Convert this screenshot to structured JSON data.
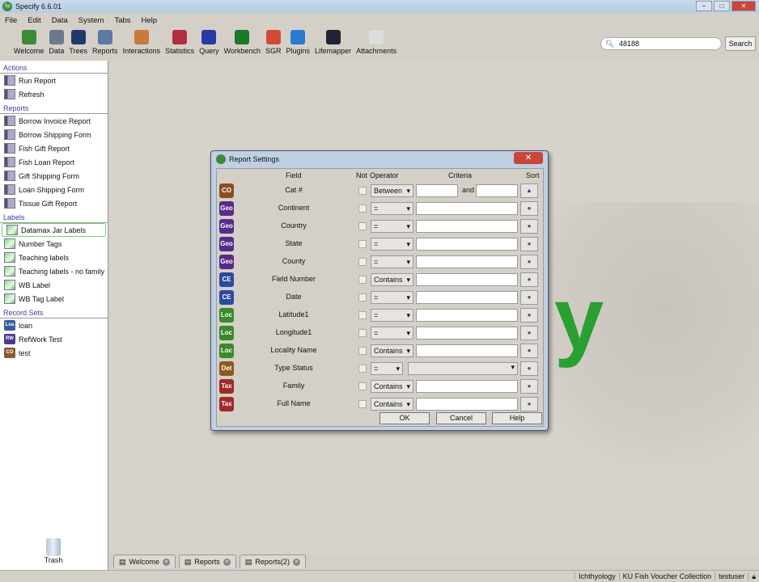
{
  "window": {
    "title": "Specify 6.6.01"
  },
  "menu": [
    "File",
    "Edit",
    "Data",
    "System",
    "Tabs",
    "Help"
  ],
  "toolbar": [
    {
      "label": "Welcome",
      "icon": "welcome-icon",
      "color": "#3a8a3a"
    },
    {
      "label": "Data",
      "icon": "data-icon",
      "color": "#6a7a8a"
    },
    {
      "label": "Trees",
      "icon": "trees-icon",
      "color": "#1f3a6a"
    },
    {
      "label": "Reports",
      "icon": "reports-icon",
      "color": "#5a7aa8"
    },
    {
      "label": "Interactions",
      "icon": "interactions-icon",
      "color": "#c87a3a"
    },
    {
      "label": "Statistics",
      "icon": "statistics-icon",
      "color": "#b03040"
    },
    {
      "label": "Query",
      "icon": "query-icon",
      "color": "#2a3aa0"
    },
    {
      "label": "Workbench",
      "icon": "workbench-icon",
      "color": "#1a7a2a"
    },
    {
      "label": "SGR",
      "icon": "sgr-icon",
      "color": "#d04a3a"
    },
    {
      "label": "Plugins",
      "icon": "plugins-icon",
      "color": "#2a7ad0"
    },
    {
      "label": "Lifemapper",
      "icon": "lifemapper-icon",
      "color": "#223"
    },
    {
      "label": "Attachments",
      "icon": "attachments-icon",
      "color": "#ddd"
    }
  ],
  "search": {
    "value": "48188",
    "button": "Search"
  },
  "sidebar": {
    "actions": {
      "title": "Actions",
      "items": [
        "Run Report",
        "Refresh"
      ]
    },
    "reports": {
      "title": "Reports",
      "items": [
        "Borrow Invoice Report",
        "Borrow Shipping Form",
        "Fish Gift Report",
        "Fish Loan Report",
        "Gift Shipping Form",
        "Loan Shipping Form",
        "Tissue Gift Report"
      ]
    },
    "labels": {
      "title": "Labels",
      "items": [
        "Datamax Jar Labels",
        "Number Tags",
        "Teaching labels",
        "Teaching labels - no family",
        "WB Label",
        "WB Tag Label"
      ],
      "selected": "Datamax Jar Labels"
    },
    "record_sets": {
      "title": "Record Sets",
      "items": [
        {
          "badge": "Loa",
          "label": "loan",
          "color": "#3a5aa0"
        },
        {
          "badge": "RW",
          "label": "RefWork Test",
          "color": "#4a3a8a"
        },
        {
          "badge": "CO",
          "label": "test",
          "color": "#8a5a2a"
        }
      ]
    },
    "trash": "Trash"
  },
  "logo_letter": "y",
  "tabs": [
    "Welcome",
    "Reports",
    "Reports(2)"
  ],
  "status": [
    "Ichthyology",
    "KU Fish Voucher Collection",
    "testuser"
  ],
  "dialog": {
    "title": "Report Settings",
    "headers": {
      "field": "Field",
      "not": "Not",
      "operator": "Operator",
      "criteria": "Criteria",
      "sort": "Sort"
    },
    "rows": [
      {
        "badge": "CO",
        "color": "#8a5020",
        "field": "Cat #",
        "operator": "Between",
        "between": "and",
        "sort": "ascending"
      },
      {
        "badge": "Geo",
        "color": "#5a2a8a",
        "field": "Continent",
        "operator": "="
      },
      {
        "badge": "Geo",
        "color": "#5a2a8a",
        "field": "Country",
        "operator": "="
      },
      {
        "badge": "Geo",
        "color": "#5a2a8a",
        "field": "State",
        "operator": "="
      },
      {
        "badge": "Geo",
        "color": "#5a2a8a",
        "field": "County",
        "operator": "="
      },
      {
        "badge": "CE",
        "color": "#2a4aa0",
        "field": "Field Number",
        "operator": "Contains"
      },
      {
        "badge": "CE",
        "color": "#2a4aa0",
        "field": "Date",
        "operator": "="
      },
      {
        "badge": "Loc",
        "color": "#3a8a2a",
        "field": "Latitude1",
        "operator": "="
      },
      {
        "badge": "Loc",
        "color": "#3a8a2a",
        "field": "Longitude1",
        "operator": "="
      },
      {
        "badge": "Loc",
        "color": "#3a8a2a",
        "field": "Locality Name",
        "operator": "Contains"
      },
      {
        "badge": "Det",
        "color": "#8a5a20",
        "field": "Type Status",
        "operator": "=",
        "dropdown": true
      },
      {
        "badge": "Tax",
        "color": "#a02a2a",
        "field": "Family",
        "operator": "Contains"
      },
      {
        "badge": "Tax",
        "color": "#a02a2a",
        "field": "Full Name",
        "operator": "Contains"
      }
    ],
    "buttons": {
      "ok": "OK",
      "cancel": "Cancel",
      "help": "Help"
    }
  }
}
